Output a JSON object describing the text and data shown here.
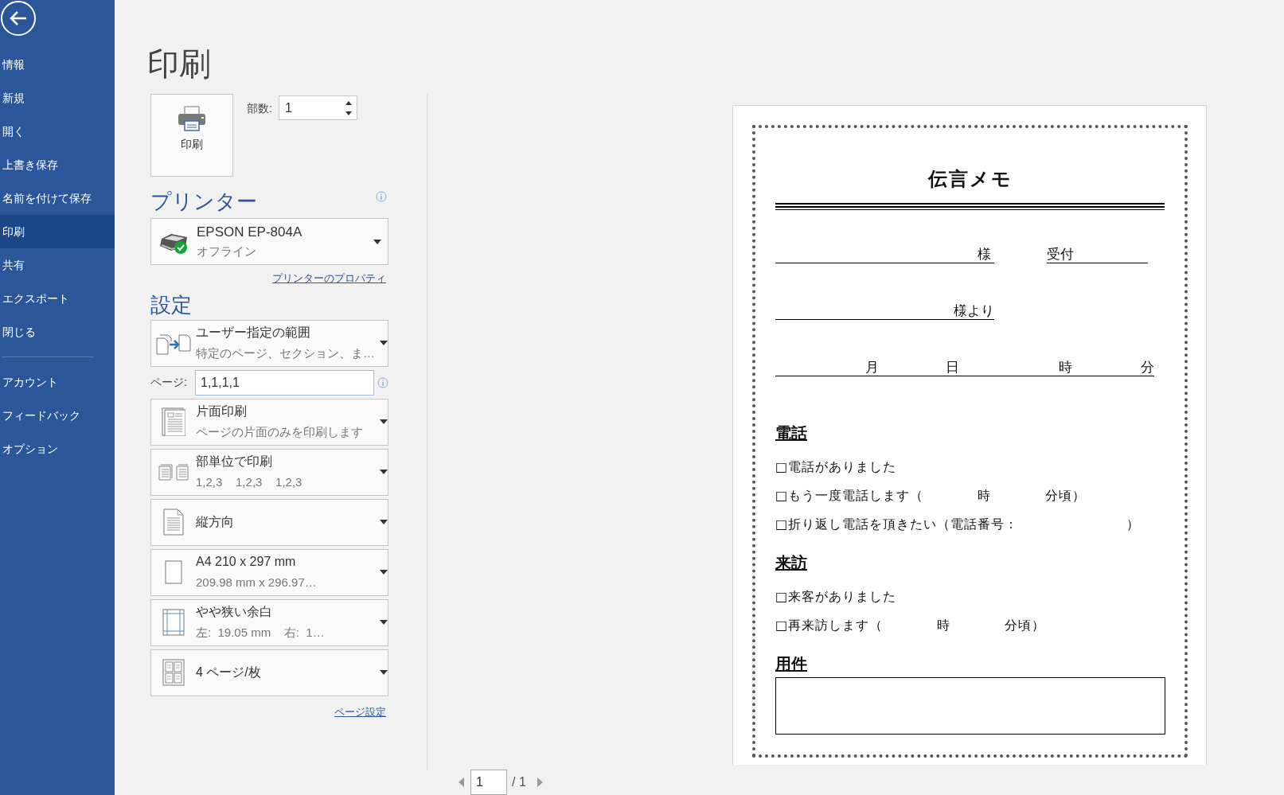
{
  "sidebar": {
    "items": [
      {
        "label": "情報",
        "selected": false
      },
      {
        "label": "新規",
        "selected": false
      },
      {
        "label": "開く",
        "selected": false
      },
      {
        "label": "上書き保存",
        "selected": false
      },
      {
        "label": "名前を付けて保存",
        "selected": false
      },
      {
        "label": "印刷",
        "selected": true
      },
      {
        "label": "共有",
        "selected": false
      },
      {
        "label": "エクスポート",
        "selected": false
      },
      {
        "label": "閉じる",
        "selected": false
      }
    ],
    "bottom_items": [
      {
        "label": "アカウント",
        "selected": false
      },
      {
        "label": "フィードバック",
        "selected": false
      },
      {
        "label": "オプション",
        "selected": false
      }
    ]
  },
  "title": "印刷",
  "print_button": {
    "label": "印刷"
  },
  "copies": {
    "label": "部数:",
    "value": "1"
  },
  "printer": {
    "heading": "プリンター",
    "name": "EPSON EP-804A",
    "status": "オフライン",
    "properties_link": "プリンターのプロパティ"
  },
  "settings": {
    "heading": "設定",
    "range": {
      "kind": "range",
      "title": "ユーザー指定の範囲",
      "subtitle": "特定のページ、セクション、ま…"
    },
    "pages": {
      "label": "ページ:",
      "value": "1,1,1,1"
    },
    "options": [
      {
        "kind": "sides",
        "title": "片面印刷",
        "subtitle": "ページの片面のみを印刷します"
      },
      {
        "kind": "collate",
        "title": "部単位で印刷",
        "subtitle": "1,2,3    1,2,3    1,2,3"
      },
      {
        "kind": "orientation",
        "title": "縦方向"
      },
      {
        "kind": "paper",
        "title": "A4 210 x 297 mm",
        "subtitle": "209.98 mm x 296.97…"
      },
      {
        "kind": "margins",
        "title": "やや狭い余白",
        "subtitle": "左:  19.05 mm    右:  1…"
      },
      {
        "kind": "pages_per_sheet",
        "title": "4 ページ/枚"
      }
    ],
    "page_setup_link": "ページ設定"
  },
  "preview": {
    "title": "伝言メモ",
    "addressee_label": "様",
    "received_label": "受付",
    "caller_label": "様より",
    "datetime_labels": [
      "月",
      "日",
      "時",
      "分"
    ],
    "sections": [
      {
        "kind": "list",
        "heading": "電話",
        "items": [
          "□電話がありました",
          "□もう一度電話します（　　　　時　　　　分頃）",
          "□折り返し電話を頂きたい（電話番号：　　　　　　　　）"
        ]
      },
      {
        "kind": "list",
        "heading": "来訪",
        "items": [
          "□来客がありました",
          "□再来訪します（　　　　時　　　　分頃）"
        ]
      },
      {
        "kind": "box",
        "heading": "用件"
      }
    ]
  },
  "page_nav": {
    "current": "1",
    "total": "/ 1"
  }
}
